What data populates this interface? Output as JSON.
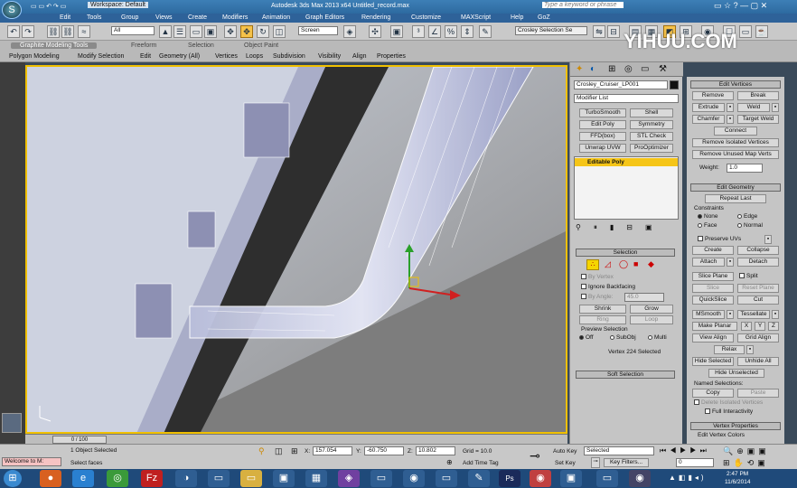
{
  "titlebar": {
    "workspace": "Workspace: Default",
    "title": "Autodesk 3ds Max 2013 x64     Untitled_record.max",
    "search_placeholder": "Type a keyword or phrase"
  },
  "menu": [
    "Edit",
    "Tools",
    "Group",
    "Views",
    "Create",
    "Modifiers",
    "Animation",
    "Graph Editors",
    "Rendering",
    "Customize",
    "MAXScript",
    "Help",
    "GoZ"
  ],
  "toolbar": {
    "filter": "All",
    "refcoord": "Screen",
    "selset": "Crosley Selection Se"
  },
  "ribbon": {
    "tabs": [
      "Graphite Modeling Tools",
      "Freeform",
      "Selection",
      "Object Paint"
    ],
    "items": [
      "Polygon Modeling",
      "Modify Selection",
      "Edit",
      "Geometry (All)",
      "Vertices",
      "Loops",
      "Subdivision",
      "Visibility",
      "Align",
      "Properties"
    ]
  },
  "watermark": "YIHUU.COM",
  "cmd": {
    "object_name": "Crosley_Cruiser_LP001",
    "modifier_list": "Modifier List",
    "mod_buttons": [
      "TurboSmooth",
      "Shell",
      "Edit Poly",
      "Symmetry",
      "FFD(box)",
      "STL Check",
      "Unwrap UVW",
      "ProOptimizer"
    ],
    "stack_item": "Editable Poly",
    "selection_title": "Selection",
    "by_vertex": "By Vertex",
    "ignore_backfacing": "Ignore Backfacing",
    "by_angle": "By Angle:",
    "by_angle_value": "45.0",
    "shrink": "Shrink",
    "grow": "Grow",
    "ring": "Ring",
    "loop": "Loop",
    "preview_selection": "Preview Selection",
    "preview_opts": [
      "Off",
      "SubObj",
      "Multi"
    ],
    "status": "Vertex 224 Selected",
    "soft_selection": "Soft Selection"
  },
  "right": {
    "edit_vertices": "Edit Vertices",
    "remove": "Remove",
    "break": "Break",
    "extrude": "Extrude",
    "weld": "Weld",
    "chamfer": "Chamfer",
    "target_weld": "Target Weld",
    "connect": "Connect",
    "remove_isolated": "Remove Isolated Vertices",
    "remove_unused": "Remove Unused Map Verts",
    "weight_label": "Weight:",
    "weight_value": "1.0",
    "edit_geometry": "Edit Geometry",
    "repeat_last": "Repeat Last",
    "constraints": "Constraints",
    "c_none": "None",
    "c_edge": "Edge",
    "c_face": "Face",
    "c_normal": "Normal",
    "preserve_uvs": "Preserve UVs",
    "create": "Create",
    "collapse": "Collapse",
    "attach": "Attach",
    "detach": "Detach",
    "slice_plane": "Slice Plane",
    "split": "Split",
    "slice": "Slice",
    "reset_plane": "Reset Plane",
    "quickslice": "QuickSlice",
    "cut": "Cut",
    "msmooth": "MSmooth",
    "tessellate": "Tessellate",
    "make_planar": "Make Planar",
    "x": "X",
    "y": "Y",
    "z": "Z",
    "view_align": "View Align",
    "grid_align": "Grid Align",
    "relax": "Relax",
    "hide_selected": "Hide Selected",
    "unhide_all": "Unhide All",
    "hide_unselected": "Hide Unselected",
    "named_selections": "Named Selections:",
    "copy": "Copy",
    "paste": "Paste",
    "delete_isolated": "Delete Isolated Vertices",
    "full_interactivity": "Full Interactivity",
    "vertex_properties": "Vertex Properties",
    "edit_vertex_colors": "Edit Vertex Colors"
  },
  "timeslider": "0 / 100",
  "status": {
    "welcome": "Welcome to M:",
    "objects": "1 Object Selected",
    "prompt": "Select faces",
    "x_label": "X:",
    "x": "157.054",
    "y_label": "Y:",
    "y": "-60.750",
    "z_label": "Z:",
    "z": "10.802",
    "grid": "Grid = 10.0",
    "add_time_tag": "Add Time Tag",
    "auto_key": "Auto Key",
    "set_key": "Set Key",
    "selected": "Selected",
    "key_filters": "Key Filters...",
    "frame": "0"
  },
  "clock": {
    "time": "2:47 PM",
    "date": "11/6/2014"
  }
}
